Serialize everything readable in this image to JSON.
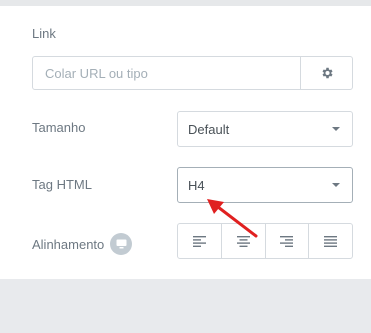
{
  "link": {
    "label": "Link",
    "placeholder": "Colar URL ou tipo"
  },
  "size": {
    "label": "Tamanho",
    "selected": "Default"
  },
  "html_tag": {
    "label": "Tag HTML",
    "selected": "H4"
  },
  "alignment": {
    "label": "Alinhamento",
    "options": [
      "left",
      "center",
      "right",
      "justify"
    ]
  },
  "colors": {
    "annotation_arrow": "#e02020",
    "border": "#d5dadf",
    "label": "#6d7882"
  }
}
